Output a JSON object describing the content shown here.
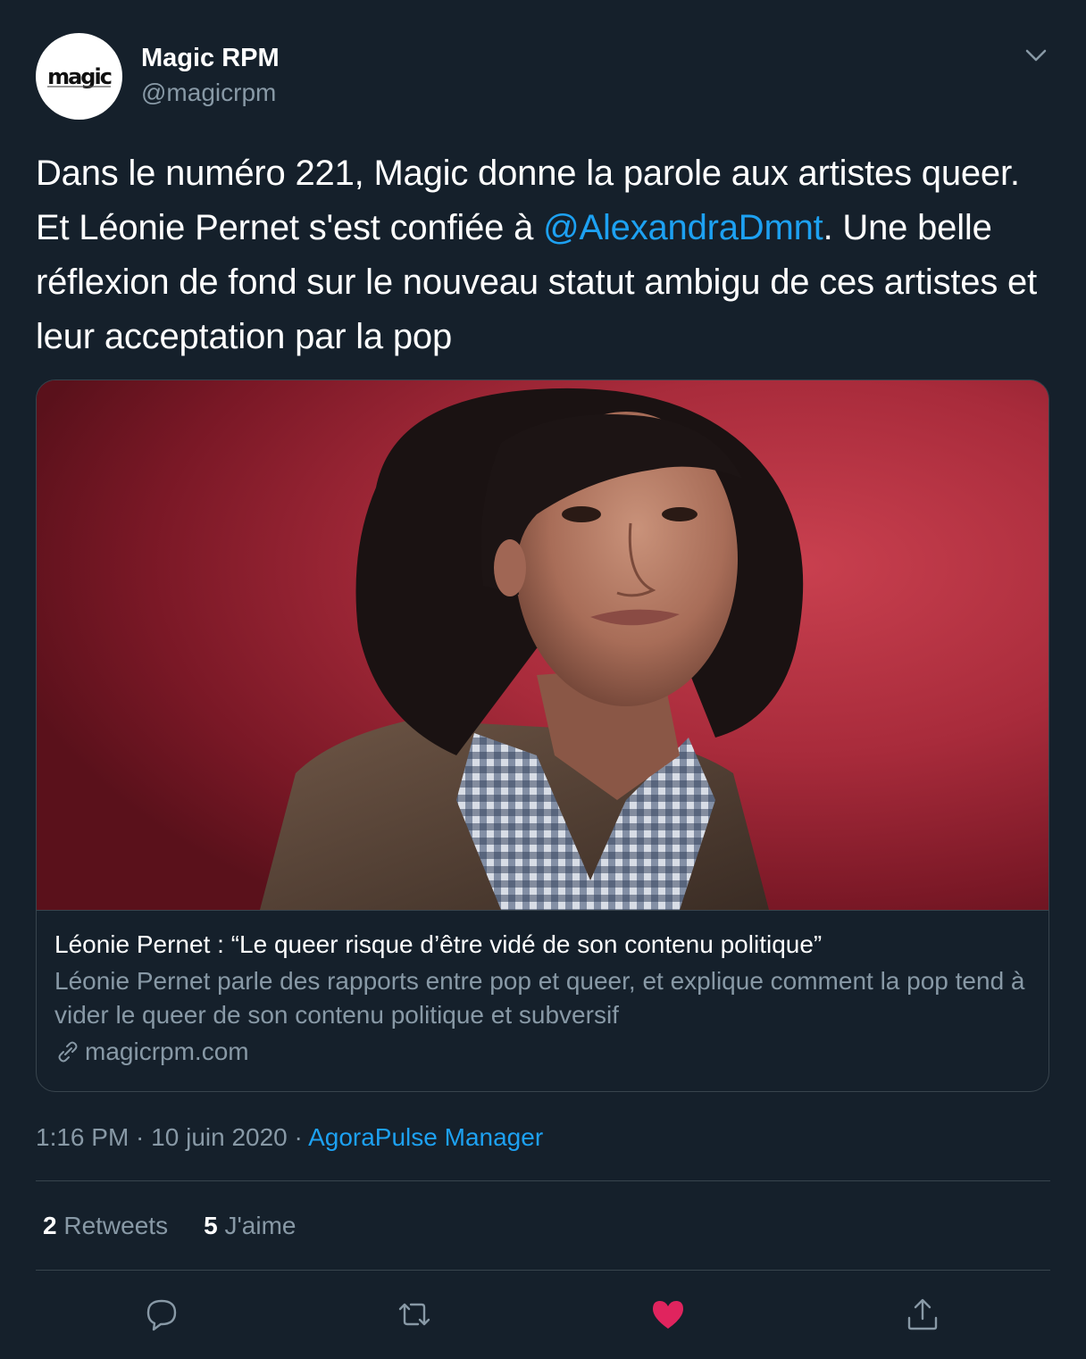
{
  "author": {
    "display_name": "Magic RPM",
    "handle": "@magicrpm",
    "avatar_text": "magic"
  },
  "tweet": {
    "text_part1": "Dans le numéro 221, Magic donne la parole aux artistes queer. Et Léonie Pernet s'est confiée à ",
    "mention": "@AlexandraDmnt",
    "text_part2": ". Une belle réflexion de fond sur le nouveau statut ambigu de ces artistes et leur acceptation par la pop"
  },
  "card": {
    "title": "Léonie Pernet : “Le queer risque d’être vidé de son contenu politique”",
    "description": "Léonie Pernet parle des rapports entre pop et queer, et explique comment la pop tend à vider le queer de son contenu politique et subversif",
    "domain": "magicrpm.com"
  },
  "meta": {
    "time": "1:16 PM",
    "separator1": " · ",
    "date": "10 juin 2020",
    "separator2": " · ",
    "source": "AgoraPulse Manager"
  },
  "stats": {
    "retweets_count": "2",
    "retweets_label": "Retweets",
    "likes_count": "5",
    "likes_label": "J'aime"
  },
  "colors": {
    "background": "#15202b",
    "link": "#1da1f2",
    "secondary_text": "#8899a6",
    "border": "#38444d",
    "like_active": "#e0245e"
  },
  "icons": {
    "caret": "chevron-down-icon",
    "link": "link-icon",
    "reply": "reply-icon",
    "retweet": "retweet-icon",
    "like": "heart-icon",
    "share": "share-icon"
  }
}
